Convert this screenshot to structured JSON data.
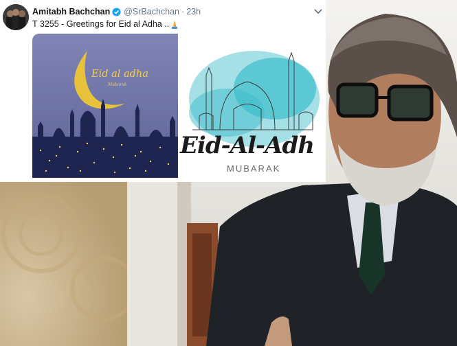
{
  "tweet": {
    "display_name": "Amitabh Bachchan",
    "handle": "@SrBachchan",
    "separator": "·",
    "time": "23h",
    "text": "T 3255 - Greetings for Eid al Adha ..",
    "emoji_icon": "folded-hands-icon",
    "verified_icon": "verified-badge-icon",
    "menu_icon": "chevron-down-icon"
  },
  "media_left": {
    "title": "Eid al adha",
    "subtitle": "Mubarak"
  },
  "media_right": {
    "title": "Eid-Al-Adh",
    "subtitle": "MUBARAK"
  },
  "colors": {
    "left_bg": "#7a7fb0",
    "skyline": "#1d2550",
    "moon": "#e8c23a",
    "splash": "#1fb4c4"
  }
}
